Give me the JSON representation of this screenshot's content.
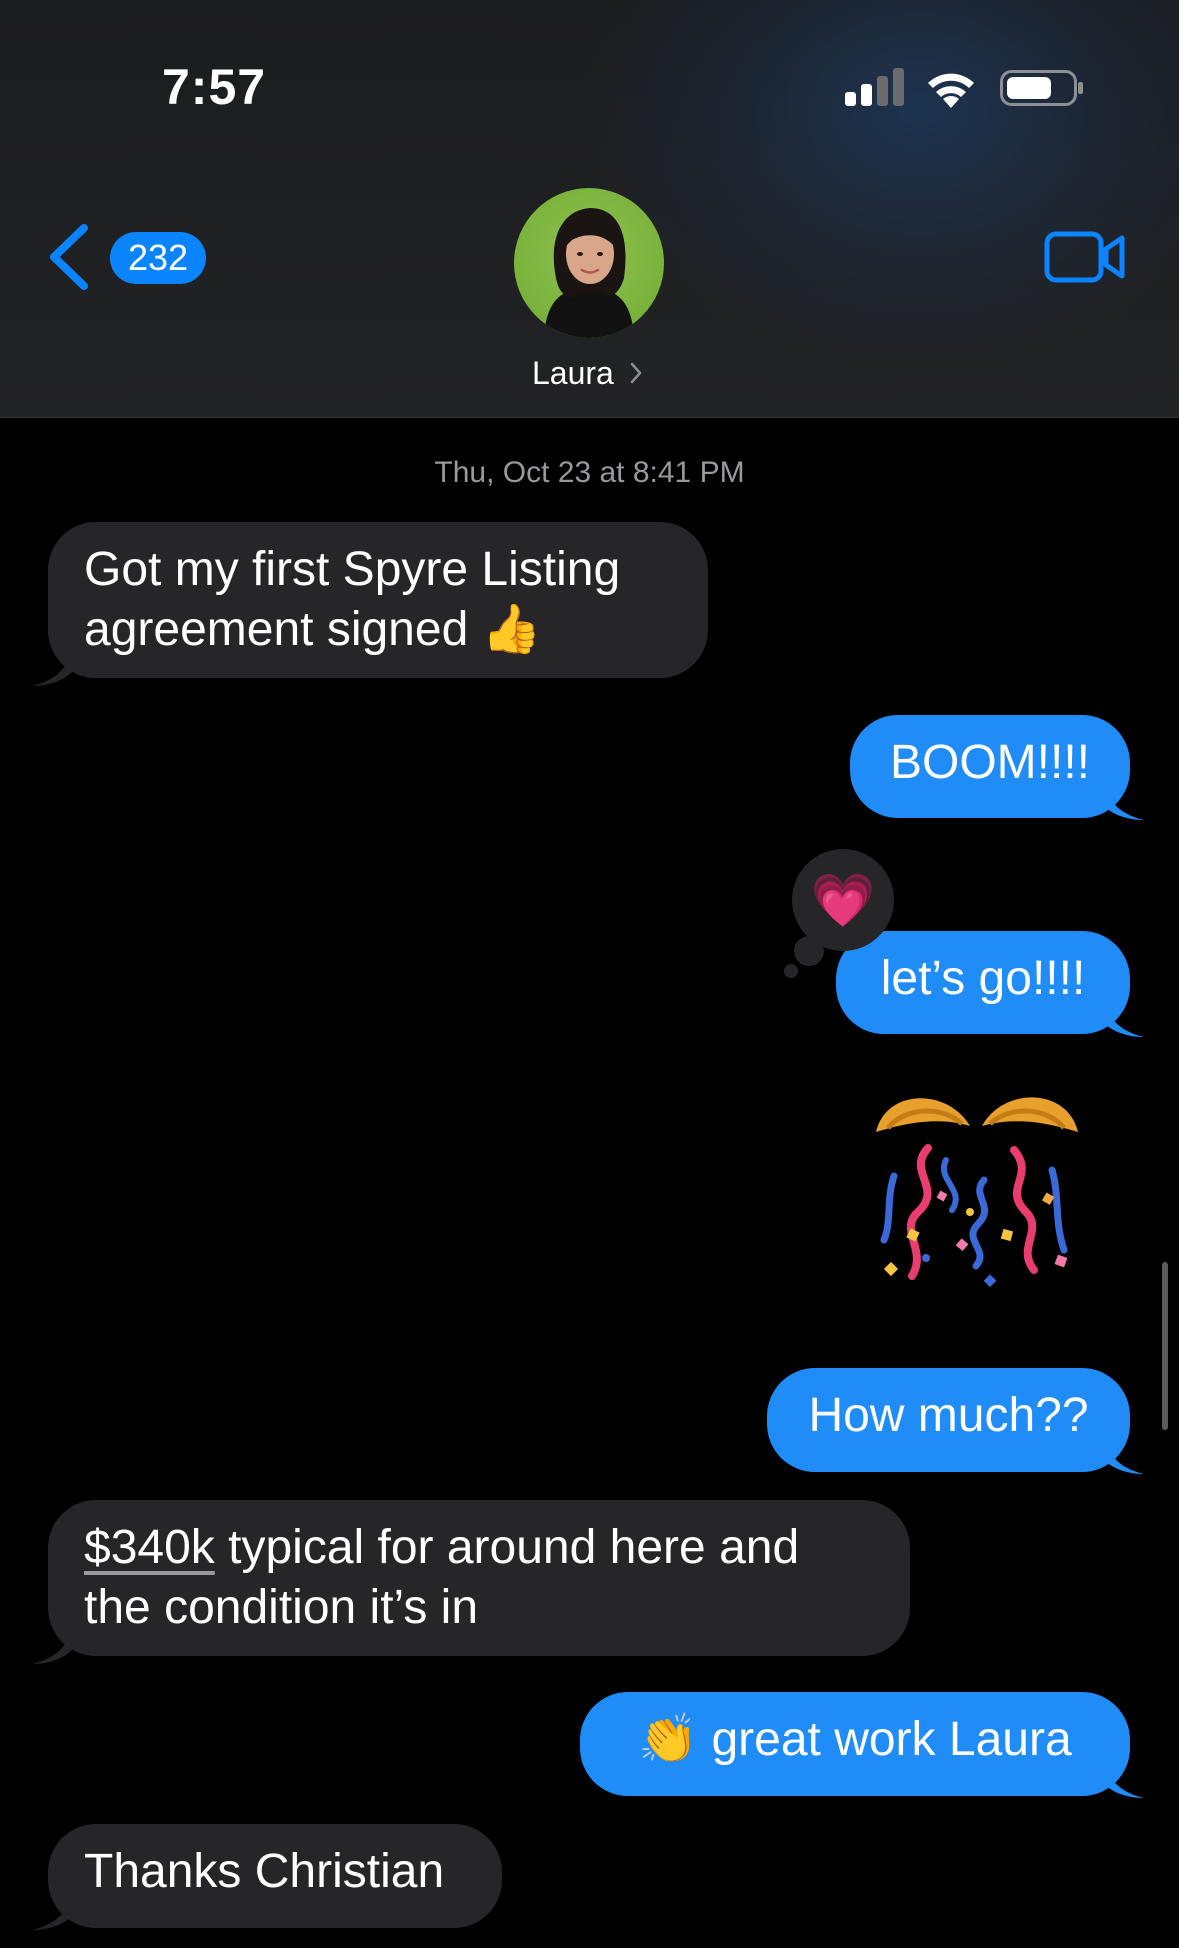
{
  "status_bar": {
    "time": "7:57",
    "icons": [
      "cellular-signal-icon",
      "wifi-icon",
      "battery-icon"
    ]
  },
  "nav": {
    "back_badge_count": "232",
    "contact_name": "Laura",
    "icons": [
      "chevron-left-icon",
      "chevron-right-icon",
      "video-camera-icon"
    ],
    "accent_color": "#0a84ff"
  },
  "conversation": {
    "timestamp": "Thu, Oct 23 at 8:41 PM",
    "messages": [
      {
        "from": "them",
        "text_line1": "Got my first Spyre Listing",
        "text_line2": "agreement signed",
        "emoji": "👍"
      },
      {
        "from": "me",
        "text": "BOOM!!!!"
      },
      {
        "from": "me",
        "text": "let’s go!!!!",
        "reaction": "💗"
      },
      {
        "from": "me",
        "sticker": "🎊"
      },
      {
        "from": "me",
        "text": "How much??"
      },
      {
        "from": "them",
        "text_link": "$340k",
        "text_rest": " typical for around here and",
        "text_line2": "the condition it’s in"
      },
      {
        "from": "me",
        "emoji": "👏",
        "text": "great work Laura"
      },
      {
        "from": "them",
        "text": "Thanks Christian"
      }
    ],
    "colors": {
      "incoming": "#262629",
      "outgoing": "#1f8cf8"
    }
  }
}
